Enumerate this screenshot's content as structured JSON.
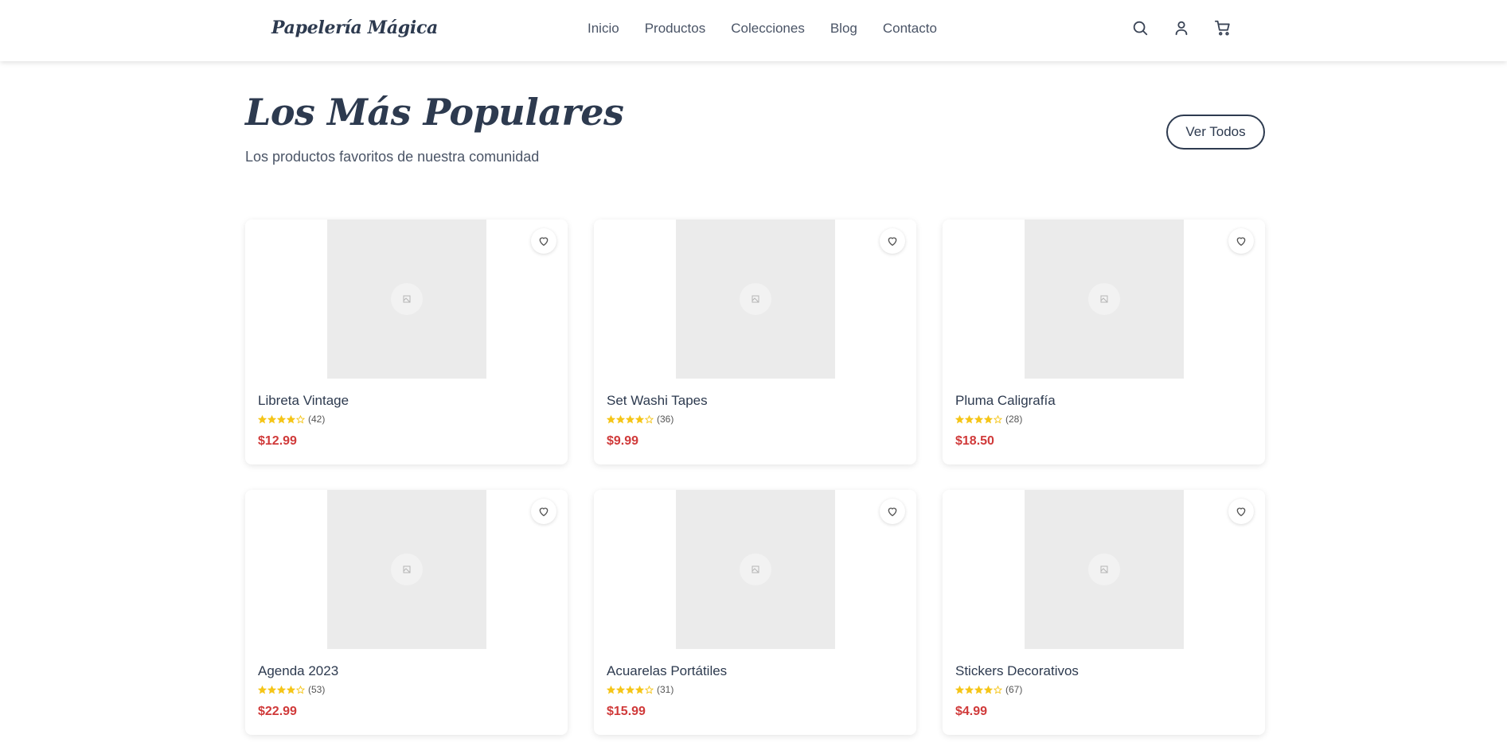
{
  "brand": "Papelería Mágica",
  "nav": [
    "Inicio",
    "Productos",
    "Colecciones",
    "Blog",
    "Contacto"
  ],
  "header_icons": [
    "search-icon",
    "user-icon",
    "cart-icon"
  ],
  "section": {
    "title": "Los Más Populares",
    "subtitle": "Los productos favoritos de nuestra comunidad",
    "view_all_label": "Ver Todos"
  },
  "products": [
    {
      "name": "Libreta Vintage",
      "rating": 4,
      "reviews": "(42)",
      "price": "$12.99"
    },
    {
      "name": "Set Washi Tapes",
      "rating": 4,
      "reviews": "(36)",
      "price": "$9.99"
    },
    {
      "name": "Pluma Caligrafía",
      "rating": 4,
      "reviews": "(28)",
      "price": "$18.50"
    },
    {
      "name": "Agenda 2023",
      "rating": 4,
      "reviews": "(53)",
      "price": "$22.99"
    },
    {
      "name": "Acuarelas Portátiles",
      "rating": 4,
      "reviews": "(31)",
      "price": "$15.99"
    },
    {
      "name": "Stickers Decorativos",
      "rating": 4,
      "reviews": "(67)",
      "price": "$4.99"
    }
  ],
  "colors": {
    "text_dark": "#2d3a4f",
    "price": "#d03a3a",
    "star": "#f5c518",
    "placeholder": "#ebebeb"
  }
}
